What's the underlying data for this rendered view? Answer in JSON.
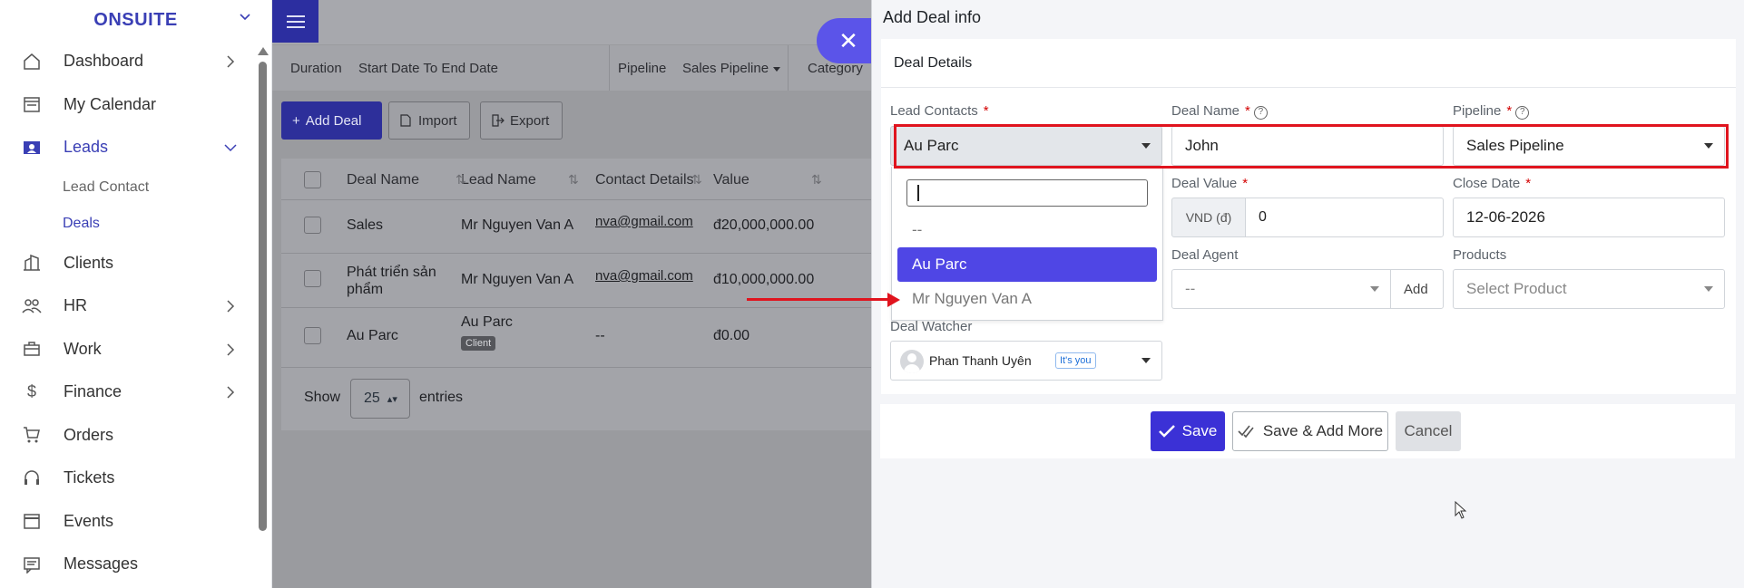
{
  "sidebar": {
    "brand": "ONSUITE",
    "items": [
      {
        "label": "Dashboard",
        "icon": "home-icon",
        "arrow": true
      },
      {
        "label": "My Calendar",
        "icon": "calendar-icon",
        "arrow": false
      },
      {
        "label": "Leads",
        "icon": "leads-icon",
        "arrow": "down",
        "active": true
      },
      {
        "label": "Clients",
        "icon": "clients-icon",
        "arrow": false
      },
      {
        "label": "HR",
        "icon": "hr-icon",
        "arrow": true
      },
      {
        "label": "Work",
        "icon": "work-icon",
        "arrow": true
      },
      {
        "label": "Finance",
        "icon": "dollar-icon",
        "arrow": true
      },
      {
        "label": "Orders",
        "icon": "cart-icon",
        "arrow": false
      },
      {
        "label": "Tickets",
        "icon": "headset-icon",
        "arrow": false
      },
      {
        "label": "Events",
        "icon": "event-icon",
        "arrow": false
      },
      {
        "label": "Messages",
        "icon": "message-icon",
        "arrow": false
      }
    ],
    "sub_items": [
      {
        "label": "Lead Contact"
      },
      {
        "label": "Deals"
      }
    ]
  },
  "filters": {
    "duration_label": "Duration",
    "date_range": "Start Date To End Date",
    "pipeline_label": "Pipeline",
    "pipeline_value": "Sales Pipeline",
    "category_label": "Category"
  },
  "actions": {
    "add_deal": "Add Deal",
    "import": "Import",
    "export": "Export"
  },
  "table": {
    "headers": [
      "Deal Name",
      "Lead Name",
      "Contact Details",
      "Value"
    ],
    "rows": [
      {
        "deal": "Sales",
        "lead": "Mr Nguyen Van A",
        "contact": "nva@gmail.com",
        "value": "đ20,000,000.00"
      },
      {
        "deal": "Phát triển sản phẩm",
        "lead": "Mr Nguyen Van A",
        "contact": "nva@gmail.com",
        "value": "đ10,000,000.00"
      },
      {
        "deal": "Au Parc",
        "lead": "Au Parc",
        "badge": "Client",
        "contact": "--",
        "value": "đ0.00"
      }
    ],
    "show_label": "Show",
    "page_size": "25",
    "entries_label": "entries"
  },
  "modal": {
    "title": "Add Deal info",
    "section": "Deal Details",
    "lead_contacts_label": "Lead Contacts",
    "lead_contacts_value": "Au Parc",
    "deal_name_label": "Deal Name",
    "deal_name_value": "John",
    "pipeline_label": "Pipeline",
    "pipeline_value": "Sales Pipeline",
    "deal_value_label": "Deal Value",
    "currency_prefix": "VND (đ)",
    "deal_value": "0",
    "close_date_label": "Close Date",
    "close_date_value": "12-06-2026",
    "deal_agent_label": "Deal Agent",
    "deal_agent_value": "--",
    "add_label": "Add",
    "products_label": "Products",
    "products_placeholder": "Select Product",
    "deal_watcher_label": "Deal Watcher",
    "watcher_name": "Phan Thanh Uyên",
    "watcher_badge": "It's you",
    "required_mark": "*",
    "help_mark": "?",
    "dropdown": {
      "options": [
        "--",
        "Au Parc",
        "Mr Nguyen Van A"
      ],
      "selected": "Au Parc"
    },
    "save": "Save",
    "save_add_more": "Save & Add More",
    "cancel": "Cancel"
  },
  "colors": {
    "accent": "#4f46e5",
    "highlight": "#e0141e"
  }
}
